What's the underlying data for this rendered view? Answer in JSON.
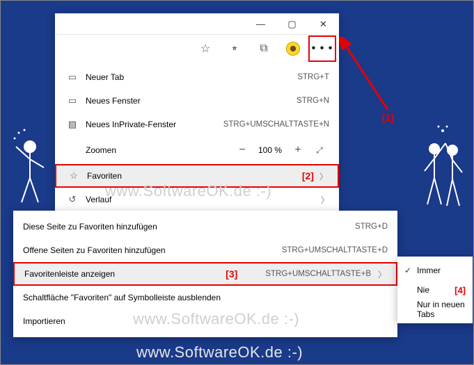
{
  "titlebar": {
    "minimize": "—",
    "maximize": "▢",
    "close": "✕"
  },
  "toolbar": {
    "star": "☆",
    "starplus": "⭒",
    "collections": "⧉",
    "more": "• • •"
  },
  "menu": {
    "new_tab": {
      "label": "Neuer Tab",
      "shortcut": "STRG+T"
    },
    "new_window": {
      "label": "Neues Fenster",
      "shortcut": "STRG+N"
    },
    "new_inprivate": {
      "label": "Neues InPrivate-Fenster",
      "shortcut": "STRG+UMSCHALTTASTE+N"
    },
    "zoom": {
      "label": "Zoomen",
      "percent": "100 %"
    },
    "favorites": {
      "label": "Favoriten"
    },
    "history": {
      "label": "Verlauf"
    }
  },
  "submenu": {
    "add_page": {
      "label": "Diese Seite zu Favoriten hinzufügen",
      "shortcut": "STRG+D"
    },
    "add_open": {
      "label": "Offene Seiten zu Favoriten hinzufügen",
      "shortcut": "STRG+UMSCHALTTASTE+D"
    },
    "show_bar": {
      "label": "Favoritenleiste anzeigen",
      "shortcut": "STRG+UMSCHALTTASTE+B"
    },
    "hide_button": {
      "label": "Schaltfläche \"Favoriten\" auf Symbolleiste ausblenden"
    },
    "import": {
      "label": "Importieren"
    }
  },
  "flyout": {
    "always": "Immer",
    "never": "Nie",
    "newtabs": "Nur in neuen Tabs"
  },
  "annotations": {
    "a1": "[1]",
    "a2": "[2]",
    "a3": "[3]",
    "a4": "[4]"
  },
  "watermark": "www.SoftwareOK.de :-)"
}
